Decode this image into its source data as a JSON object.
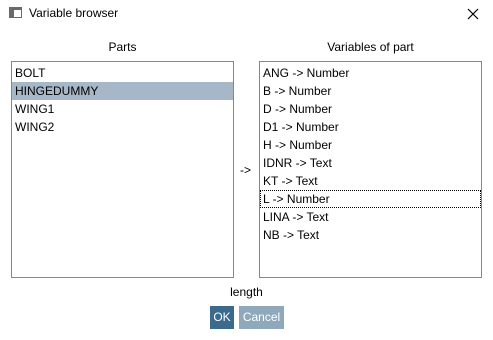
{
  "window": {
    "title": "Variable browser"
  },
  "parts": {
    "label": "Parts",
    "items": [
      "BOLT",
      "HINGEDUMMY",
      "WING1",
      "WING2"
    ],
    "selected_index": 1
  },
  "arrow_label": "->",
  "variables": {
    "label": "Variables of part",
    "items": [
      "ANG -> Number",
      "B -> Number",
      "D -> Number",
      "D1 -> Number",
      "H -> Number",
      "IDNR -> Text",
      "KT -> Text",
      "L -> Number",
      "LINA -> Text",
      "NB -> Text"
    ],
    "focused_index": 7
  },
  "status_text": "length",
  "buttons": {
    "ok_label": "OK",
    "cancel_label": "Cancel"
  },
  "colors": {
    "selection": "#a6b8c8",
    "ok_button": "#3c6a8c",
    "cancel_button": "#8fa8ba",
    "list_border": "#828790"
  }
}
